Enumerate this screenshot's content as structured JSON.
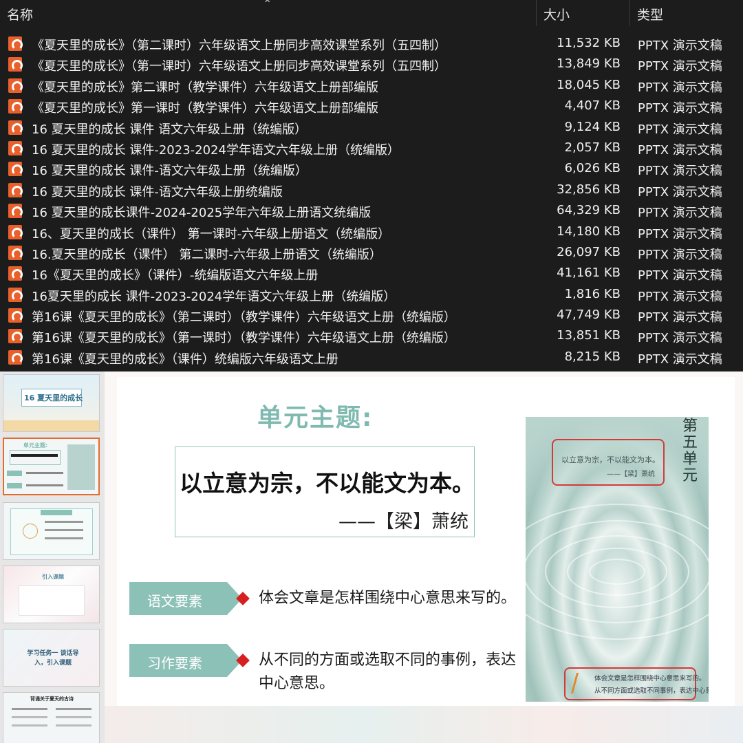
{
  "explorer": {
    "columns": {
      "name": "名称",
      "size": "大小",
      "type": "类型"
    },
    "files": [
      {
        "name": "《夏天里的成长》（第二课时）六年级语文上册同步高效课堂系列（五四制）",
        "size": "11,532 KB",
        "type": "PPTX 演示文稿"
      },
      {
        "name": "《夏天里的成长》（第一课时）六年级语文上册同步高效课堂系列（五四制）",
        "size": "13,849 KB",
        "type": "PPTX 演示文稿"
      },
      {
        "name": "《夏天里的成长》第二课时（教学课件）六年级语文上册部编版",
        "size": "18,045 KB",
        "type": "PPTX 演示文稿"
      },
      {
        "name": "《夏天里的成长》第一课时（教学课件）六年级语文上册部编版",
        "size": "4,407 KB",
        "type": "PPTX 演示文稿"
      },
      {
        "name": "16 夏天里的成长 课件 语文六年级上册（统编版）",
        "size": "9,124 KB",
        "type": "PPTX 演示文稿"
      },
      {
        "name": "16 夏天里的成长 课件-2023-2024学年语文六年级上册（统编版）",
        "size": "2,057 KB",
        "type": "PPTX 演示文稿"
      },
      {
        "name": "16 夏天里的成长 课件-语文六年级上册（统编版）",
        "size": "6,026 KB",
        "type": "PPTX 演示文稿"
      },
      {
        "name": "16 夏天里的成长 课件-语文六年级上册统编版",
        "size": "32,856 KB",
        "type": "PPTX 演示文稿"
      },
      {
        "name": "16 夏天里的成长课件-2024-2025学年六年级上册语文统编版",
        "size": "64,329 KB",
        "type": "PPTX 演示文稿"
      },
      {
        "name": "16、夏天里的成长（课件） 第一课时-六年级上册语文（统编版）",
        "size": "14,180 KB",
        "type": "PPTX 演示文稿"
      },
      {
        "name": "16.夏天里的成长（课件） 第二课时-六年级上册语文（统编版）",
        "size": "26,097 KB",
        "type": "PPTX 演示文稿"
      },
      {
        "name": "16《夏天里的成长》（课件）-统编版语文六年级上册",
        "size": "41,161 KB",
        "type": "PPTX 演示文稿"
      },
      {
        "name": "16夏天里的成长 课件-2023-2024学年语文六年级上册（统编版）",
        "size": "1,816 KB",
        "type": "PPTX 演示文稿"
      },
      {
        "name": "第16课《夏天里的成长》（第二课时）（教学课件）六年级语文上册（统编版）",
        "size": "47,749 KB",
        "type": "PPTX 演示文稿"
      },
      {
        "name": "第16课《夏天里的成长》（第一课时）（教学课件）六年级语文上册（统编版）",
        "size": "13,851 KB",
        "type": "PPTX 演示文稿"
      },
      {
        "name": "第16课《夏天里的成长》（课件）统编版六年级语文上册",
        "size": "8,215 KB",
        "type": "PPTX 演示文稿"
      }
    ]
  },
  "thumbnails": [
    {
      "title": "16 夏天里的成长"
    },
    {
      "title": "单元主题:"
    },
    {
      "title": ""
    },
    {
      "title": "引入课题"
    },
    {
      "title": "学习任务一 谈话导入，引入课题"
    },
    {
      "title": "背诵关于夏天的古诗"
    }
  ],
  "slide": {
    "title": "单元主题:",
    "quote": "以立意为宗，不以能文为本。",
    "quote_author": "——【梁】萧统",
    "requirements": [
      {
        "tag": "语文要素",
        "text": "体会文章是怎样围绕中心意思来写的。"
      },
      {
        "tag": "习作要素",
        "text": "从不同的方面或选取不同的事例，表达中心意思。"
      }
    ],
    "book": {
      "unit": "第五单元",
      "quote": "以立意为宗，不以能文为本。",
      "quote_author": "——【梁】萧统",
      "foot_line1": "体会文章是怎样围绕中心意思来写的。",
      "foot_line2": "从不同方面或选取不同事例，表达中心意思。"
    }
  },
  "colors": {
    "accent_teal": "#8cc1b8",
    "diamond_red": "#d81f1f",
    "pptx_icon": "#e8602b"
  }
}
